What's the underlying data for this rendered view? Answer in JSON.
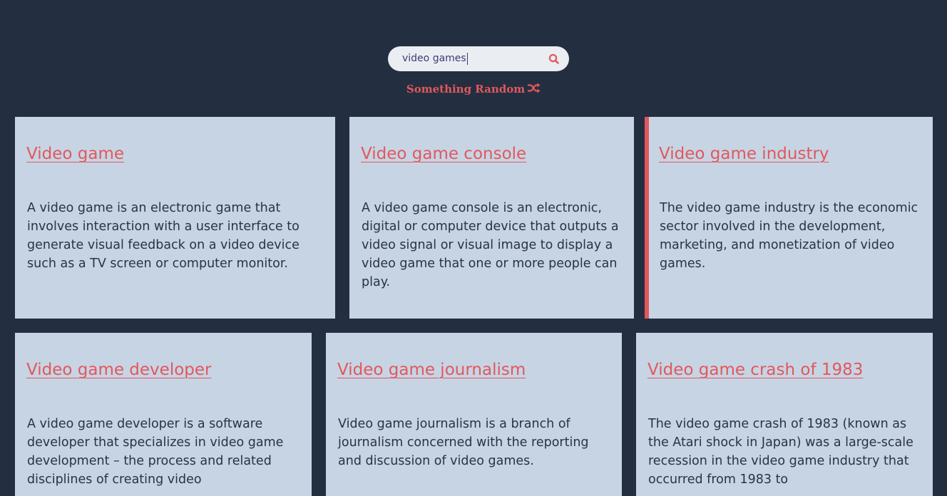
{
  "search": {
    "value": "video games",
    "icon": "search-icon"
  },
  "random": {
    "label": "Something Random",
    "icon": "shuffle-icon"
  },
  "colors": {
    "background": "#232f40",
    "card": "#c7d4e4",
    "accent": "#e2585c",
    "text": "#2a3342"
  },
  "results": [
    {
      "title": "Video game",
      "text": "A video game is an electronic game that involves interaction with a user interface to generate visual feedback on a video device such as a TV screen or computer monitor."
    },
    {
      "title": "Video game console",
      "text": "A video game console is an electronic, digital or computer device that outputs a video signal or visual image to display a video game that one or more people can play."
    },
    {
      "title": "Video game industry",
      "text": "The video game industry is the economic sector involved in the development, marketing, and monetization of video games."
    },
    {
      "title": "Video game developer",
      "text": "A video game developer is a software developer that specializes in video game development – the process and related disciplines of creating video"
    },
    {
      "title": "Video game journalism",
      "text": "Video game journalism is a branch of journalism concerned with the reporting and discussion of video games."
    },
    {
      "title": "Video game crash of 1983",
      "text": "The video game crash of 1983 (known as the Atari shock in Japan) was a large-scale recession in the video game industry that occurred from 1983 to"
    }
  ]
}
